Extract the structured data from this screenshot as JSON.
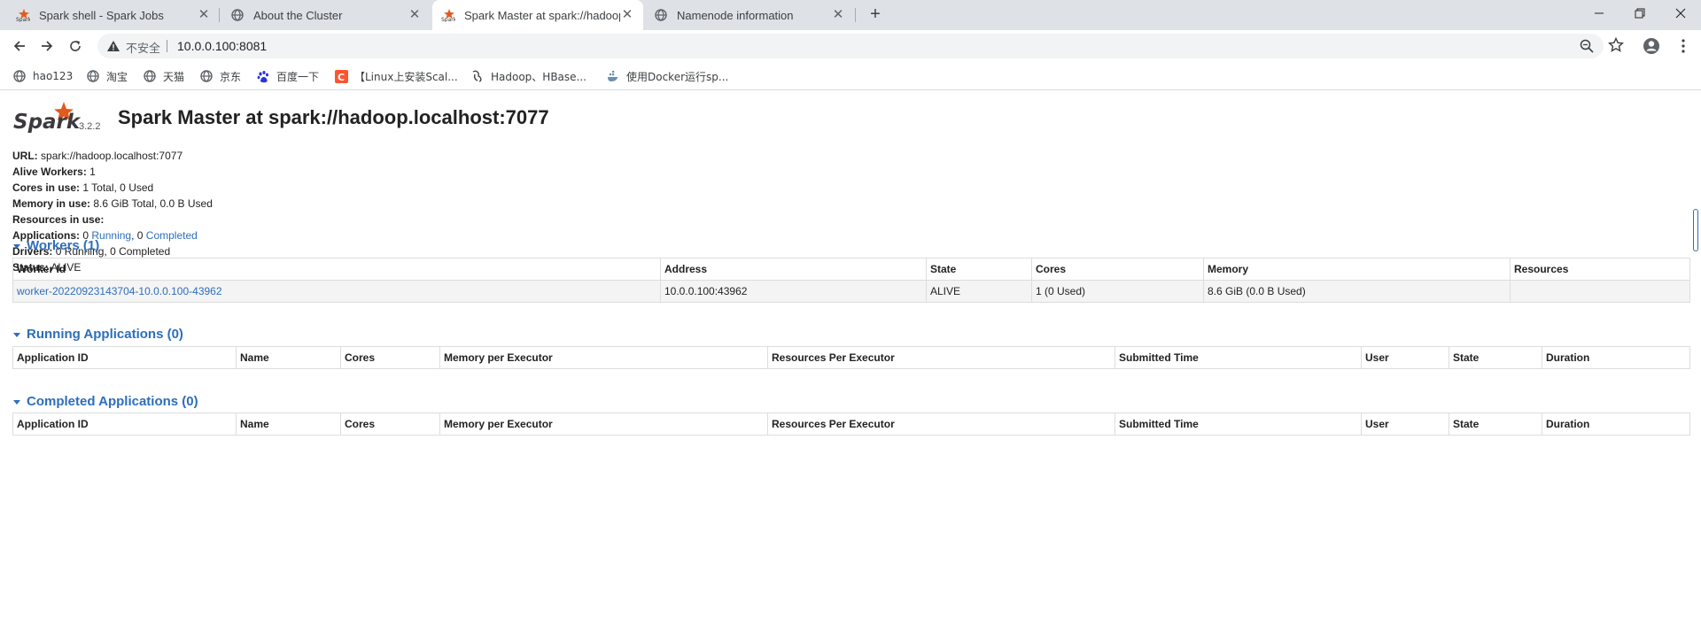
{
  "browser": {
    "tabs": [
      {
        "title": "Spark shell - Spark Jobs",
        "active": false
      },
      {
        "title": "About the Cluster",
        "active": false
      },
      {
        "title": "Spark Master at spark://hadoop.localhost:7077",
        "active": true
      },
      {
        "title": "Namenode information",
        "active": false
      }
    ],
    "address": {
      "security": "不安全",
      "url": "10.0.0.100:8081"
    },
    "bookmarks": [
      {
        "label": "hao123",
        "icon": "globe-icon"
      },
      {
        "label": "淘宝",
        "icon": "globe-icon"
      },
      {
        "label": "天猫",
        "icon": "globe-icon"
      },
      {
        "label": "京东",
        "icon": "globe-icon"
      },
      {
        "label": "百度一下",
        "icon": "baidu-paw-icon"
      },
      {
        "label": "【Linux上安装Scal...",
        "icon": "csdn-c-icon"
      },
      {
        "label": "Hadoop、HBase...",
        "icon": "hadoop-icon"
      },
      {
        "label": "使用Docker运行sp...",
        "icon": "docker-doc-icon"
      }
    ]
  },
  "page": {
    "brand_version": "3.2.2",
    "title": "Spark Master at spark://hadoop.localhost:7077",
    "summary": {
      "url_label": "URL:",
      "url_value": "spark://hadoop.localhost:7077",
      "alive_workers_label": "Alive Workers:",
      "alive_workers_value": "1",
      "cores_label": "Cores in use:",
      "cores_value": "1 Total, 0 Used",
      "memory_label": "Memory in use:",
      "memory_value": "8.6 GiB Total, 0.0 B Used",
      "resources_label": "Resources in use:",
      "applications_label": "Applications:",
      "applications_running_count": "0",
      "applications_running_link": "Running",
      "applications_completed_count": "0",
      "applications_completed_link": "Completed",
      "drivers_label": "Drivers:",
      "drivers_value": "0 Running, 0 Completed",
      "status_label": "Status:",
      "status_value": "ALIVE"
    },
    "workers": {
      "header": "Workers (1)",
      "columns": [
        "Worker Id",
        "Address",
        "State",
        "Cores",
        "Memory",
        "Resources"
      ],
      "rows": [
        {
          "worker_id": "worker-20220923143704-10.0.0.100-43962",
          "address": "10.0.0.100:43962",
          "state": "ALIVE",
          "cores": "1 (0 Used)",
          "memory": "8.6 GiB (0.0 B Used)",
          "resources": ""
        }
      ]
    },
    "running_apps": {
      "header": "Running Applications (0)",
      "columns": [
        "Application ID",
        "Name",
        "Cores",
        "Memory per Executor",
        "Resources Per Executor",
        "Submitted Time",
        "User",
        "State",
        "Duration"
      ]
    },
    "completed_apps": {
      "header": "Completed Applications (0)",
      "columns": [
        "Application ID",
        "Name",
        "Cores",
        "Memory per Executor",
        "Resources Per Executor",
        "Submitted Time",
        "User",
        "State",
        "Duration"
      ]
    }
  }
}
